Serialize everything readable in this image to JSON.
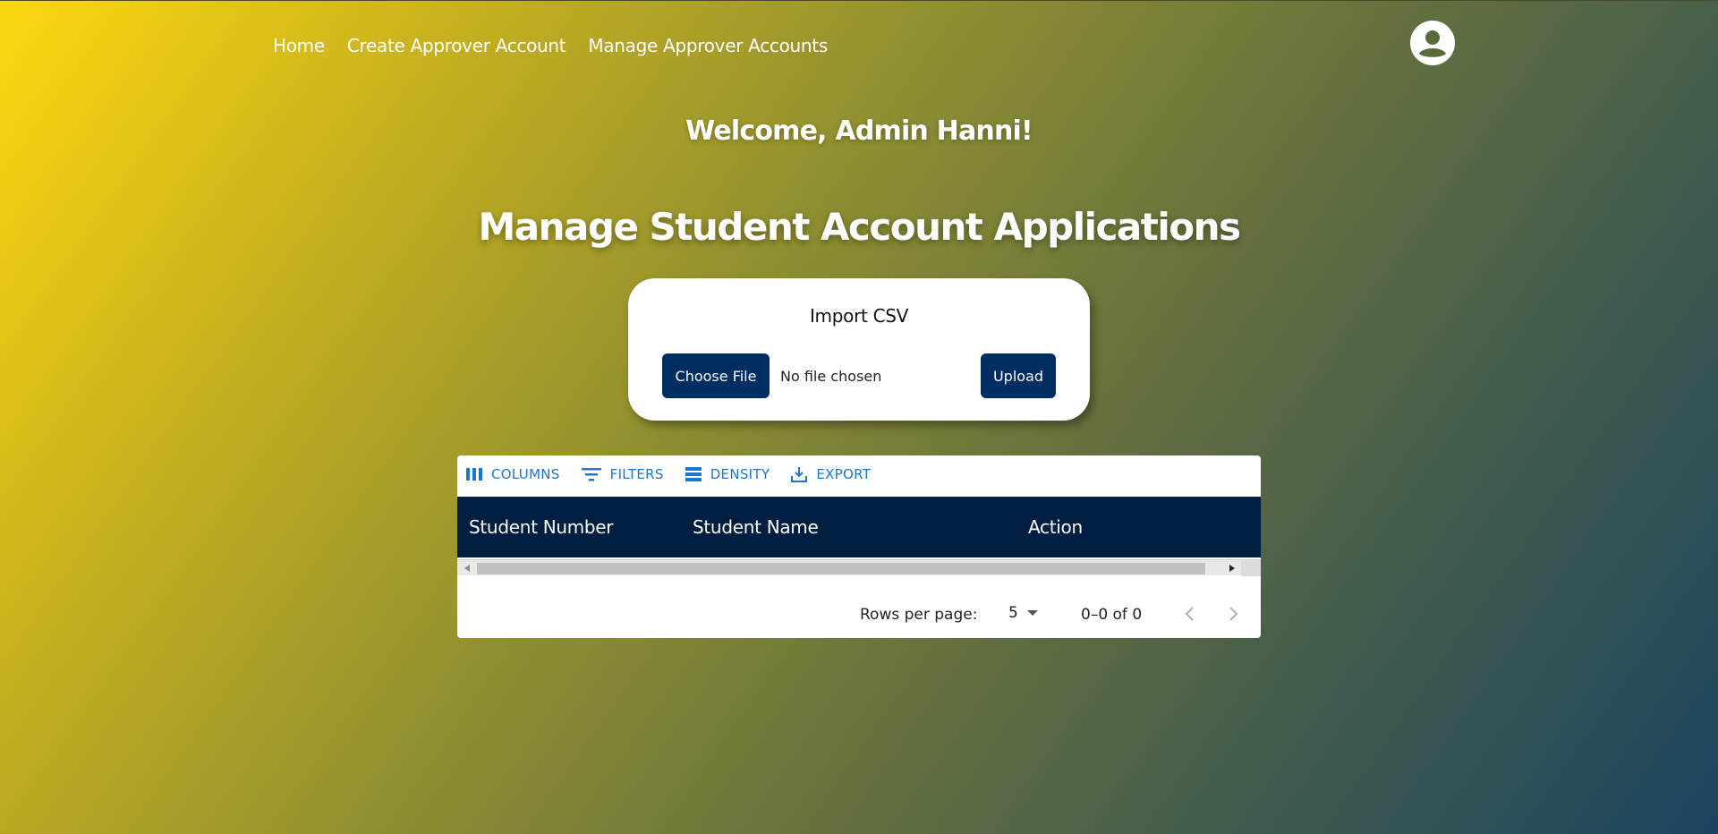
{
  "nav": {
    "home": "Home",
    "create_approver": "Create Approver Account",
    "manage_approvers": "Manage Approver Accounts"
  },
  "profile_icon": "account-circle-icon",
  "welcome": "Welcome, Admin Hanni!",
  "page_title": "Manage Student Account Applications",
  "import": {
    "title": "Import CSV",
    "choose_file": "Choose File",
    "file_status": "No file chosen",
    "upload": "Upload"
  },
  "toolbar": {
    "columns": "COLUMNS",
    "filters": "FILTERS",
    "density": "DENSITY",
    "export": "EXPORT"
  },
  "table": {
    "columns": [
      "Student Number",
      "Student Name",
      "Action"
    ],
    "rows": []
  },
  "pagination": {
    "rows_per_page_label": "Rows per page:",
    "rows_per_page": "5",
    "range": "0–0 of 0"
  },
  "colors": {
    "button": "#002d62",
    "header": "#001e41",
    "toolbar_accent": "#1976d2"
  }
}
